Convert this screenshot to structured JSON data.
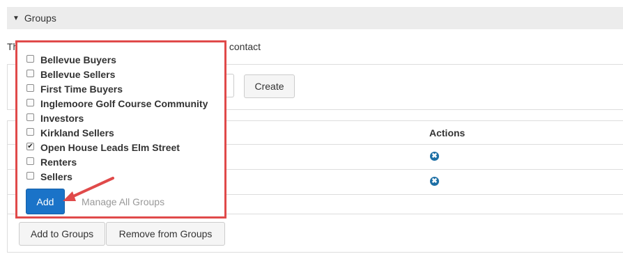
{
  "section": {
    "title": "Groups",
    "chevron_icon": "chevron-down-icon"
  },
  "intro": {
    "lead": "Th",
    "tail": "s contact"
  },
  "create": {
    "button_label": "Create"
  },
  "table": {
    "actions_header": "Actions",
    "remove_icon_glyph": "✖",
    "row_count": 2
  },
  "footer": {
    "add_to_groups_label": "Add to Groups",
    "remove_from_groups_label": "Remove from Groups"
  },
  "dropdown": {
    "groups": [
      {
        "label": "Bellevue Buyers",
        "checked": false
      },
      {
        "label": "Bellevue Sellers",
        "checked": false
      },
      {
        "label": "First Time Buyers",
        "checked": false
      },
      {
        "label": "Inglemoore Golf Course Community",
        "checked": false
      },
      {
        "label": "Investors",
        "checked": false
      },
      {
        "label": "Kirkland Sellers",
        "checked": false
      },
      {
        "label": "Open House Leads Elm Street",
        "checked": true
      },
      {
        "label": "Renters",
        "checked": false
      },
      {
        "label": "Sellers",
        "checked": false
      }
    ],
    "add_label": "Add",
    "manage_label": "Manage All Groups",
    "checkmark_glyph": "✔"
  },
  "colors": {
    "highlight_border": "#e04a4a",
    "primary_button": "#1a73c8",
    "remove_icon": "#1d6fa5",
    "header_bg": "#ececec"
  }
}
